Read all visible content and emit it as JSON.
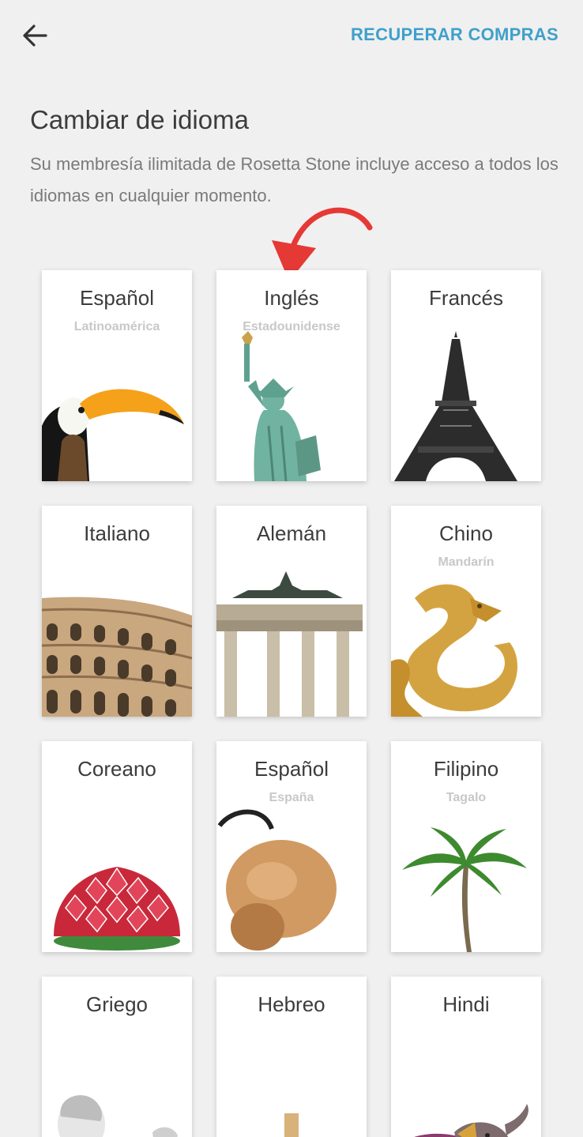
{
  "header": {
    "back_icon": "arrow-left-icon",
    "restore_label": "RECUPERAR COMPRAS"
  },
  "page": {
    "title": "Cambiar de idioma",
    "subtitle": "Su membresía ilimitada de Rosetta Stone incluye acceso a todos los idiomas en cualquier momento."
  },
  "colors": {
    "accent": "#3fa0cc",
    "annotation_arrow": "#e53935"
  },
  "languages": [
    {
      "name": "Español",
      "variant": "Latinoamérica",
      "image": "toucan"
    },
    {
      "name": "Inglés",
      "variant": "Estadounidense",
      "image": "statue-of-liberty"
    },
    {
      "name": "Francés",
      "variant": "",
      "image": "eiffel-tower"
    },
    {
      "name": "Italiano",
      "variant": "",
      "image": "colosseum"
    },
    {
      "name": "Alemán",
      "variant": "",
      "image": "brandenburg-gate"
    },
    {
      "name": "Chino",
      "variant": "Mandarín",
      "image": "golden-dragon"
    },
    {
      "name": "Coreano",
      "variant": "",
      "image": "lotus-lantern"
    },
    {
      "name": "Español",
      "variant": "España",
      "image": "castanets"
    },
    {
      "name": "Filipino",
      "variant": "Tagalo",
      "image": "palm-tree"
    },
    {
      "name": "Griego",
      "variant": "",
      "image": "greek-statue"
    },
    {
      "name": "Hebreo",
      "variant": "",
      "image": "dreidel"
    },
    {
      "name": "Hindi",
      "variant": "",
      "image": "decorated-elephant"
    }
  ]
}
